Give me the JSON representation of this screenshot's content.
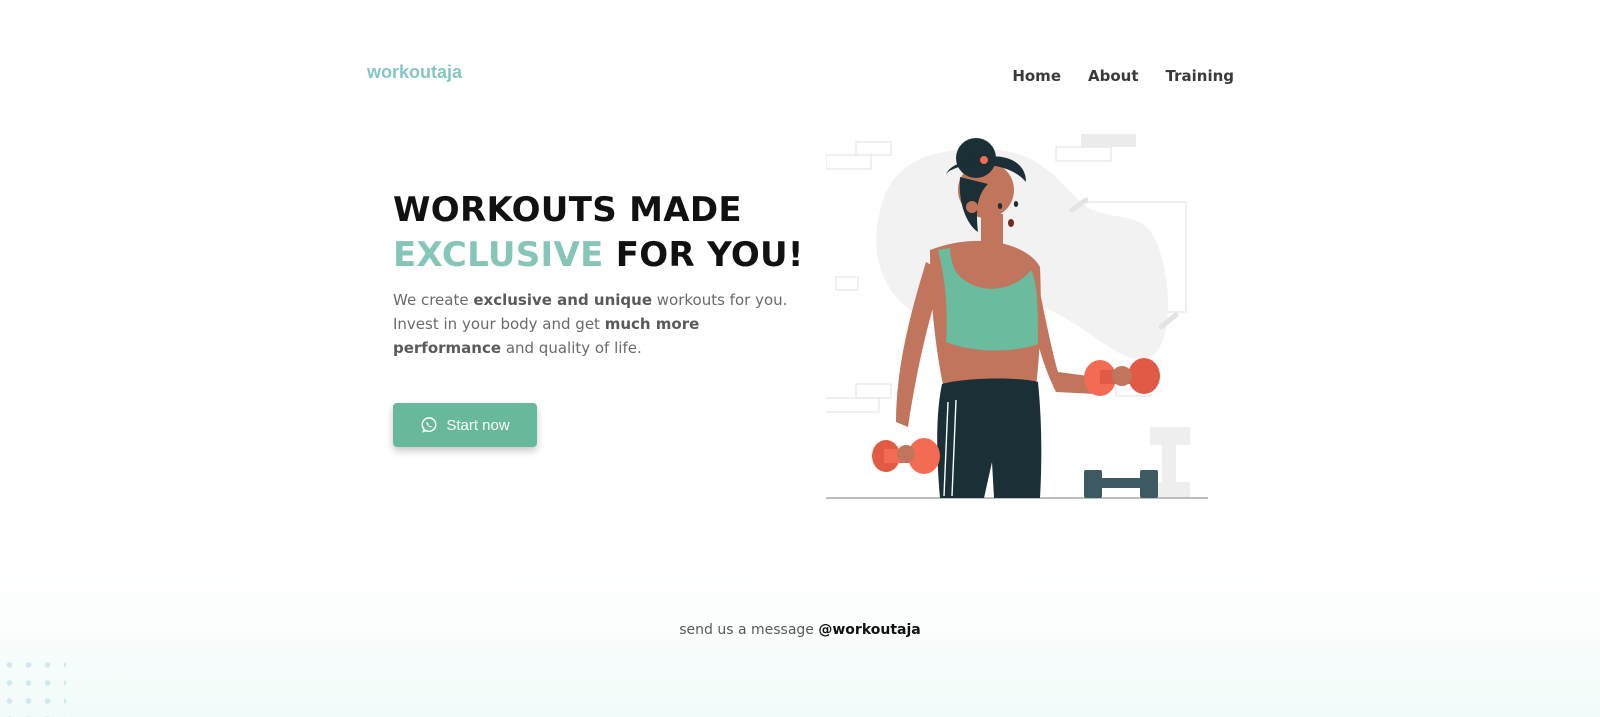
{
  "brand": {
    "logo": "workoutaja"
  },
  "nav": {
    "items": [
      "Home",
      "About",
      "Training"
    ]
  },
  "hero": {
    "headline_line1": "WORKOUTS MADE",
    "headline_accent": "EXCLUSIVE",
    "headline_rest": " FOR YOU!",
    "desc": {
      "p1": "We create ",
      "b1": "exclusive and unique",
      "p2": " workouts for you. Invest in your body and get ",
      "b2": "much more performance",
      "p3": " and quality of life."
    },
    "cta": {
      "label": "Start now",
      "icon": "whatsapp-icon"
    },
    "illustration": {
      "icon": "woman-dumbbells-illustration"
    }
  },
  "footer": {
    "text": "send us a message ",
    "handle": "@workoutaja"
  },
  "colors": {
    "accent": "#86c6b8",
    "logo": "#86c6c3",
    "button": "#68b99b",
    "dumbbell": "#f26b52",
    "dark": "#1b2f36",
    "skin": "#c0755c",
    "top": "#6bbb9f"
  }
}
